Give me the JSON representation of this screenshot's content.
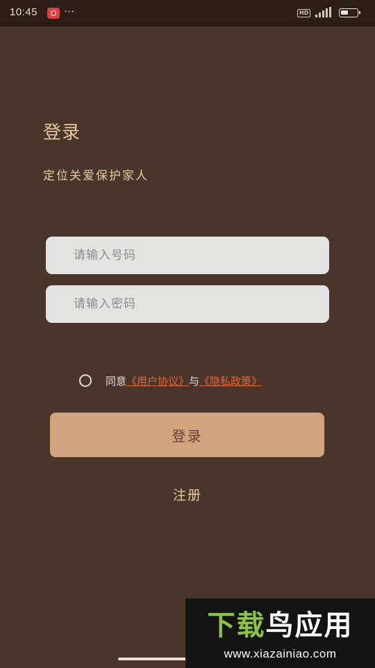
{
  "status_bar": {
    "time": "10:45",
    "dots": "···",
    "hd": "HD",
    "icons": [
      "app-notification-icon",
      "signal-icon",
      "battery-icon"
    ]
  },
  "login": {
    "title": "登录",
    "subtitle": "定位关爱保护家人",
    "phone_placeholder": "请输入号码",
    "phone_value": "",
    "password_placeholder": "请输入密码",
    "password_value": "",
    "agree_prefix": "同意",
    "user_agreement": "《用户协议》",
    "join_word": "与",
    "privacy_policy": "《隐私政策》",
    "login_button": "登录",
    "register_link": "注册"
  },
  "watermark": {
    "logo_part1": "下载",
    "logo_part2": "鸟应用",
    "url": "www.xiazainiao.com"
  },
  "colors": {
    "background": "#4a352a",
    "accent_text": "#e9c8a4",
    "button": "#d2a37c",
    "link": "#ea6630",
    "input": "#e3e4e2"
  }
}
